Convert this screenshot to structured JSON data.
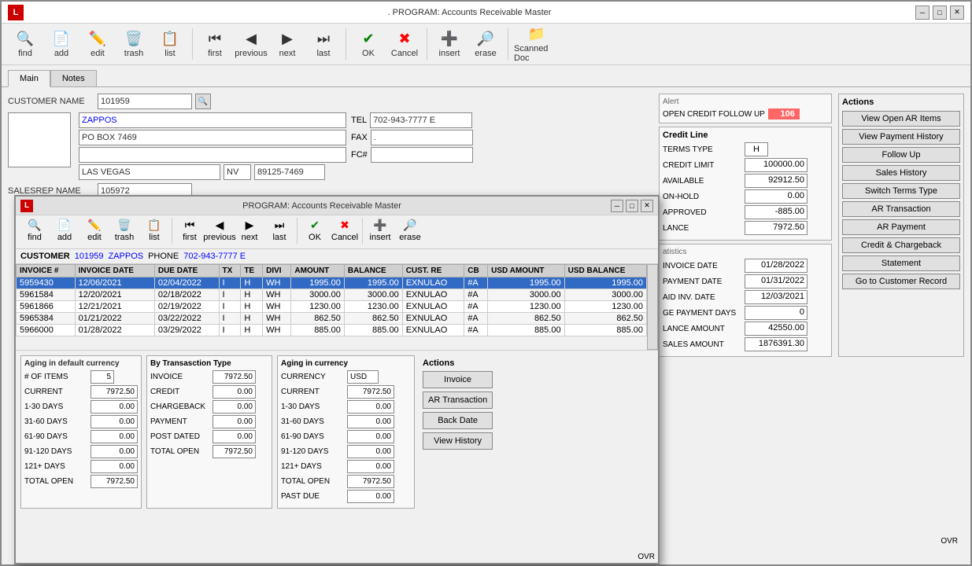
{
  "mainWindow": {
    "title": ". PROGRAM: Accounts Receivable Master",
    "logo": "L"
  },
  "toolbar": {
    "buttons": [
      {
        "label": "find",
        "icon": "🔍"
      },
      {
        "label": "add",
        "icon": "📄"
      },
      {
        "label": "edit",
        "icon": "✏️"
      },
      {
        "label": "trash",
        "icon": "🗑️"
      },
      {
        "label": "list",
        "icon": "📋"
      },
      {
        "label": "first",
        "icon": "⏮"
      },
      {
        "label": "previous",
        "icon": "◀"
      },
      {
        "label": "next",
        "icon": "▶"
      },
      {
        "label": "last",
        "icon": "⏭"
      },
      {
        "label": "OK",
        "icon": "✔"
      },
      {
        "label": "Cancel",
        "icon": "✖"
      },
      {
        "label": "insert",
        "icon": "➕"
      },
      {
        "label": "erase",
        "icon": "🔎"
      },
      {
        "label": "Scanned Doc",
        "icon": "📁"
      }
    ]
  },
  "tabs": {
    "main": "Main",
    "notes": "Notes",
    "active": "Main"
  },
  "form": {
    "customerNameLabel": "CUSTOMER NAME",
    "customerId": "101959",
    "customerName": "ZAPPOS",
    "address1": "PO BOX 7469",
    "address2": "",
    "city": "LAS VEGAS",
    "state": "NV",
    "zip": "89125-7469",
    "telLabel": "TEL",
    "tel": "702-943-7777 E",
    "faxLabel": "FAX",
    "fax": ".",
    "fcLabel": "FC#",
    "fc": "",
    "salesRepLabel": "SALESREP NAME",
    "salesRep": "105972"
  },
  "alert": {
    "title": "Alert",
    "label": "OPEN CREDIT FOLLOW UP",
    "value": "106"
  },
  "creditLine": {
    "title": "Credit Line",
    "termsTypeLabel": "TERMS TYPE",
    "termsType": "H",
    "creditLimitLabel": "CREDIT LIMIT",
    "creditLimit": "100000.00",
    "availableLabel": "AVAILABLE",
    "available": "92912.50",
    "onHoldLabel": "ON-HOLD",
    "onHold": "0.00",
    "approvedLabel": "APPROVED",
    "approved": "-885.00",
    "balanceLabel": "LANCE",
    "balance": "7972.50"
  },
  "actions": {
    "title": "Actions",
    "buttons": [
      "View Open AR Items",
      "View Payment History",
      "Follow Up",
      "Sales History",
      "Switch Terms Type",
      "AR Transaction",
      "AR Payment",
      "Credit & Chargeback",
      "Statement",
      "Go to Customer Record"
    ]
  },
  "statistics": {
    "title": "atistics",
    "invoiceDateLabel": "INVOICE DATE",
    "invoiceDate": "01/28/2022",
    "paymentDateLabel": "PAYMENT DATE",
    "paymentDate": "01/31/2022",
    "paidInvDateLabel": "AID INV. DATE",
    "paidInvDate": "12/03/2021",
    "avgPayDaysLabel": "GE PAYMENT DAYS",
    "avgPayDays": "0",
    "balanceAmtLabel": "LANCE AMOUNT",
    "balanceAmt": "42550.00",
    "salesAmtLabel": "SALES AMOUNT",
    "salesAmt": "1876391.30"
  },
  "innerDialog": {
    "title": "PROGRAM: Accounts Receivable Master",
    "customer": {
      "label": "CUSTOMER",
      "id": "101959",
      "name": "ZAPPOS",
      "phoneLabel": "PHONE",
      "phone": "702-943-7777 E"
    },
    "tableColumns": [
      "INVOICE #",
      "INVOICE DATE",
      "DUE DATE",
      "TX",
      "TE",
      "DIVI",
      "AMOUNT",
      "BALANCE",
      "CUST. RE",
      "CB",
      "USD AMOUNT",
      "USD BALANCE"
    ],
    "tableRows": [
      {
        "invoice": "5959430",
        "invoiceDate": "12/06/2021",
        "dueDate": "02/04/2022",
        "tx": "I",
        "te": "H",
        "divi": "WH",
        "amount": "1995.00",
        "balance": "1995.00",
        "custRe": "EXNULAO",
        "cb": "#A",
        "usdAmount": "1995.00",
        "usdBalance": "1995.00",
        "selected": true
      },
      {
        "invoice": "5961584",
        "invoiceDate": "12/20/2021",
        "dueDate": "02/18/2022",
        "tx": "I",
        "te": "H",
        "divi": "WH",
        "amount": "3000.00",
        "balance": "3000.00",
        "custRe": "EXNULAO",
        "cb": "#A",
        "usdAmount": "3000.00",
        "usdBalance": "3000.00",
        "selected": false
      },
      {
        "invoice": "5961866",
        "invoiceDate": "12/21/2021",
        "dueDate": "02/19/2022",
        "tx": "I",
        "te": "H",
        "divi": "WH",
        "amount": "1230.00",
        "balance": "1230.00",
        "custRe": "EXNULAO",
        "cb": "#A",
        "usdAmount": "1230.00",
        "usdBalance": "1230.00",
        "selected": false
      },
      {
        "invoice": "5965384",
        "invoiceDate": "01/21/2022",
        "dueDate": "03/22/2022",
        "tx": "I",
        "te": "H",
        "divi": "WH",
        "amount": "862.50",
        "balance": "862.50",
        "custRe": "EXNULAO",
        "cb": "#A",
        "usdAmount": "862.50",
        "usdBalance": "862.50",
        "selected": false
      },
      {
        "invoice": "5966000",
        "invoiceDate": "01/28/2022",
        "dueDate": "03/29/2022",
        "tx": "I",
        "te": "H",
        "divi": "WH",
        "amount": "885.00",
        "balance": "885.00",
        "custRe": "EXNULAO",
        "cb": "#A",
        "usdAmount": "885.00",
        "usdBalance": "885.00",
        "selected": false
      }
    ],
    "agingDefault": {
      "title": "Aging in default currency",
      "itemsLabel": "# OF ITEMS",
      "items": "5",
      "currentLabel": "CURRENT",
      "current": "7972.50",
      "days1_30Label": "1-30 DAYS",
      "days1_30": "0.00",
      "days31_60Label": "31-60 DAYS",
      "days31_60": "0.00",
      "days61_90Label": "61-90 DAYS",
      "days61_90": "0.00",
      "days91_120Label": "91-120 DAYS",
      "days91_120": "0.00",
      "days121plusLabel": "121+ DAYS",
      "days121plus": "0.00",
      "totalOpenLabel": "TOTAL OPEN",
      "totalOpen": "7972.50"
    },
    "transactionType": {
      "title": "By Transasction Type",
      "invoiceLabel": "INVOICE",
      "invoice": "7972.50",
      "creditLabel": "CREDIT",
      "credit": "0.00",
      "chargebackLabel": "CHARGEBACK",
      "chargeback": "0.00",
      "paymentLabel": "PAYMENT",
      "payment": "0.00",
      "postDatedLabel": "POST DATED",
      "postDated": "0.00",
      "totalOpenLabel": "TOTAL OPEN",
      "totalOpen": "7972.50"
    },
    "agingCurrency": {
      "title": "Aging in currency",
      "currencyLabel": "CURRENCY",
      "currency": "USD",
      "currentLabel": "CURRENT",
      "current": "7972.50",
      "days1_30Label": "1-30 DAYS",
      "days1_30": "0.00",
      "days31_60Label": "31-60 DAYS",
      "days31_60": "0.00",
      "days61_90Label": "61-90 DAYS",
      "days61_90": "0.00",
      "days91_120Label": "91-120 DAYS",
      "days91_120": "0.00",
      "days121plusLabel": "121+ DAYS",
      "days121plus": "0.00",
      "totalOpenLabel": "TOTAL OPEN",
      "totalOpen": "7972.50",
      "pastDueLabel": "PAST DUE",
      "pastDue": "0.00"
    },
    "innerActions": {
      "title": "Actions",
      "buttons": [
        "Invoice",
        "AR Transaction",
        "Back Date",
        "View History"
      ]
    },
    "ovrLabel": "OVR"
  }
}
